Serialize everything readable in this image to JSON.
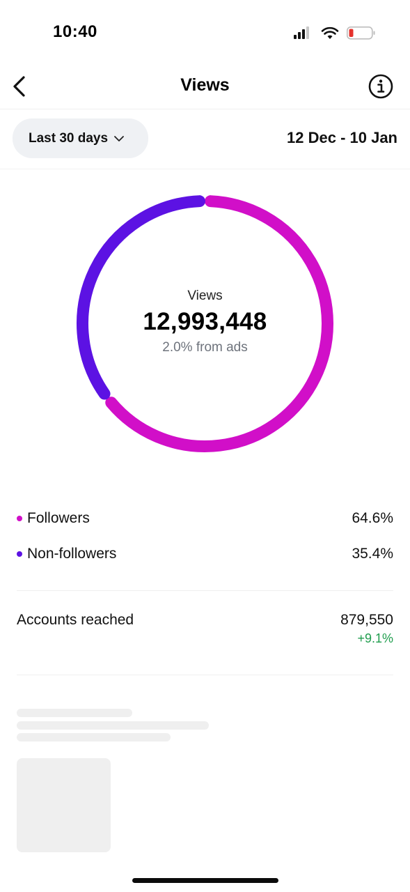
{
  "status_bar": {
    "time": "10:40",
    "icons": [
      "signal-icon",
      "wifi-icon",
      "battery-low-icon"
    ],
    "battery_color": "#e5322d"
  },
  "nav": {
    "title": "Views",
    "back_icon": "back-arrow-icon",
    "info_icon": "info-icon"
  },
  "filter": {
    "range_label": "Last 30 days",
    "date_range": "12 Dec - 10 Jan"
  },
  "donut": {
    "label": "Views",
    "value": "12,993,448",
    "subtext": "2.0% from ads",
    "segments": [
      {
        "name": "Followers",
        "percent": 64.6,
        "color": "#d10fc8"
      },
      {
        "name": "Non-followers",
        "percent": 35.4,
        "color": "#5c12e3"
      }
    ]
  },
  "breakdown": [
    {
      "label": "Followers",
      "value": "64.6%",
      "color": "#d10fc8"
    },
    {
      "label": "Non-followers",
      "value": "35.4%",
      "color": "#5c12e3"
    }
  ],
  "accounts_reached": {
    "label": "Accounts reached",
    "value": "879,550",
    "change": "+9.1%",
    "change_color": "#1f9d4d"
  }
}
